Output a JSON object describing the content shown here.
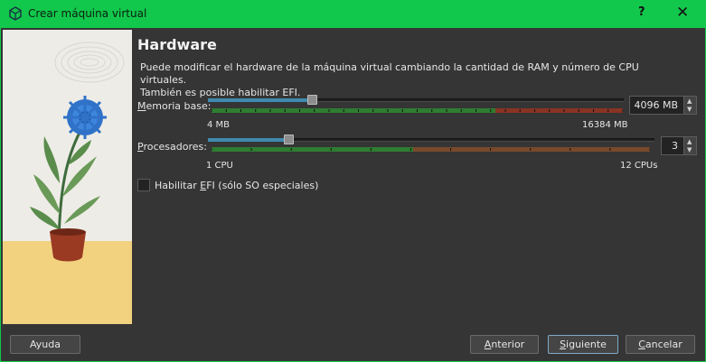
{
  "window": {
    "title": "Crear máquina virtual",
    "help_glyph": "?",
    "close_glyph": "✕",
    "accent": "#12c84c"
  },
  "page": {
    "heading": "Hardware",
    "description_line1": "Puede modificar el hardware de la máquina virtual cambiando la cantidad de RAM y número de CPU virtuales.",
    "description_line2": "También es posible habilitar EFI."
  },
  "memory": {
    "label_pre": "",
    "label_u": "M",
    "label_post": "emoria base:",
    "value": "4096 MB",
    "min_label": "4 MB",
    "max_label": "16384 MB",
    "fraction": 0.25
  },
  "processors": {
    "label_pre": "",
    "label_u": "P",
    "label_post": "rocesadores:",
    "value": "3",
    "min_label": "1 CPU",
    "max_label": "12 CPUs",
    "fraction": 0.18
  },
  "efi": {
    "label_pre": "Habilitar ",
    "label_u": "E",
    "label_post": "FI (sólo SO especiales)",
    "checked": false
  },
  "buttons": {
    "help": "Ayuda",
    "back_u": "A",
    "back_rest": "nterior",
    "next_u": "S",
    "next_rest": "iguiente",
    "cancel_u": "C",
    "cancel_rest": "ancelar"
  },
  "colors": {
    "green_bar": "#2f7d32",
    "red_bar": "#8a3322",
    "orange_bar": "#7a4a2c",
    "slider_fill": "#3f8ab0"
  }
}
